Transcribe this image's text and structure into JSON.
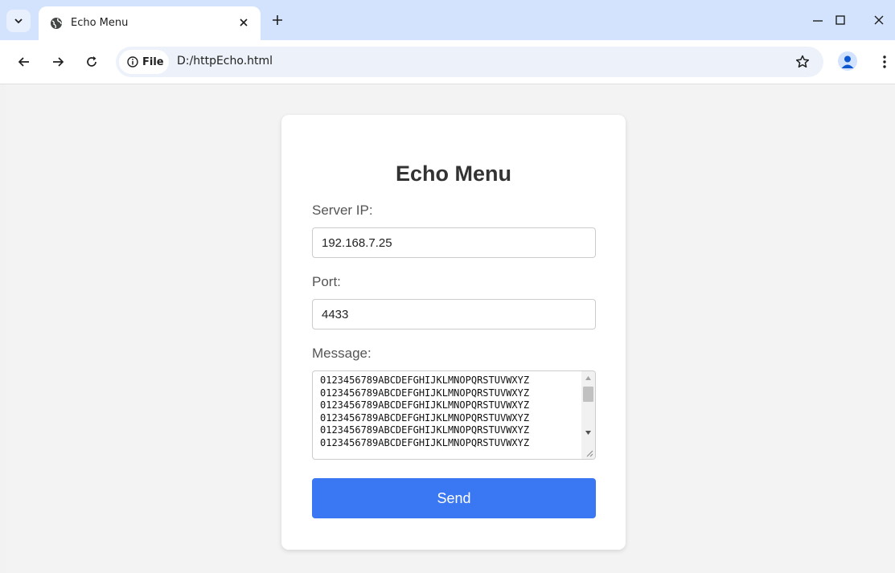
{
  "browser": {
    "tab_title": "Echo Menu",
    "site_chip_label": "File",
    "url": "D:/httpEcho.html"
  },
  "form": {
    "title": "Echo Menu",
    "server_ip_label": "Server IP:",
    "server_ip_value": "192.168.7.25",
    "port_label": "Port:",
    "port_value": "4433",
    "message_label": "Message:",
    "message_value": "0123456789ABCDEFGHIJKLMNOPQRSTUVWXYZ\n0123456789ABCDEFGHIJKLMNOPQRSTUVWXYZ\n0123456789ABCDEFGHIJKLMNOPQRSTUVWXYZ\n0123456789ABCDEFGHIJKLMNOPQRSTUVWXYZ\n0123456789ABCDEFGHIJKLMNOPQRSTUVWXYZ\n0123456789ABCDEFGHIJKLMNOPQRSTUVWXYZ",
    "send_label": "Send"
  },
  "colors": {
    "tabstrip": "#d3e3fd",
    "send_button": "#3a77f3",
    "page_background": "#f3f3f3"
  },
  "icons": [
    "tab-search-icon",
    "globe-icon",
    "close-icon",
    "plus-icon",
    "minimize-icon",
    "maximize-icon",
    "window-close-icon",
    "back-icon",
    "forward-icon",
    "reload-icon",
    "info-icon",
    "star-icon",
    "profile-icon",
    "more-icon"
  ]
}
